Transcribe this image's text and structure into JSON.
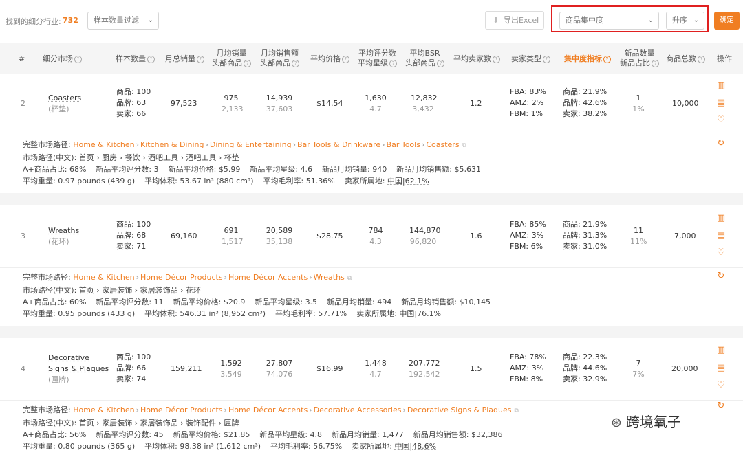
{
  "toolbar": {
    "found_label": "找到的细分行业:",
    "found_count": "732",
    "sample_filter": "样本数量过滤",
    "export": "导出Excel",
    "sort_field": "商品集中度",
    "sort_order": "升序",
    "confirm": "确定"
  },
  "headers": {
    "index": "#",
    "market": "细分市场",
    "sample": "样本数量",
    "total_sales": "月总销量",
    "avg_sales_1": "月均销量",
    "avg_sales_2": "头部商品",
    "avg_rev_1": "月均销售额",
    "avg_rev_2": "头部商品",
    "avg_price": "平均价格",
    "rating_1": "平均评分数",
    "rating_2": "平均星级",
    "bsr_1": "平均BSR",
    "bsr_2": "头部商品",
    "sellers": "平均卖家数",
    "seller_type": "卖家类型",
    "concentration": "集中度指标",
    "new_1": "新品数量",
    "new_2": "新品占比",
    "total_products": "商品总数",
    "ops": "操作"
  },
  "labels": {
    "product": "商品:",
    "brand": "品牌:",
    "seller": "卖家:",
    "fba": "FBA:",
    "amz": "AMZ:",
    "fbm": "FBM:",
    "full_path": "完整市场路径:",
    "path_cn": "市场路径(中文):",
    "aplus": "A+商品占比:",
    "new_rating_count": "新品平均评分数:",
    "new_price": "新品平均价格:",
    "new_stars": "新品平均星级:",
    "new_sales": "新品月均销量:",
    "new_revenue": "新品月均销售额:",
    "avg_weight": "平均重量:",
    "avg_volume": "平均体积:",
    "avg_margin": "平均毛利率:",
    "seller_origin": "卖家所属地:"
  },
  "rows": [
    {
      "index": "2",
      "name_en": "Coasters",
      "name_cn": "(杯垫)",
      "sample_products": "100",
      "sample_brands": "63",
      "sample_sellers": "66",
      "total_sales": "97,523",
      "avg_sales": "975",
      "avg_sales_top": "2,133",
      "avg_rev": "14,939",
      "avg_rev_top": "37,603",
      "price": "$14.54",
      "rating_count": "1,630",
      "rating_star": "4.7",
      "bsr": "12,832",
      "bsr_top": "3,432",
      "sellers": "1.2",
      "fba": "83%",
      "amz": "2%",
      "fbm": "1%",
      "conc_product": "21.9%",
      "conc_brand": "42.6%",
      "conc_seller": "38.2%",
      "new_count": "1",
      "new_ratio": "1%",
      "total_products": "10,000",
      "path_en": [
        "Home & Kitchen",
        "Kitchen & Dining",
        "Dining & Entertaining",
        "Bar Tools & Drinkware",
        "Bar Tools",
        "Coasters"
      ],
      "path_cn": "首页 › 厨房 › 餐饮 › 酒吧工具 › 酒吧工具 › 杯垫",
      "aplus": "68%",
      "new_rating_count": "3",
      "new_price": "$5.99",
      "new_stars": "4.6",
      "new_sales": "940",
      "new_revenue": "$5,631",
      "weight": "0.97 pounds (439 g)",
      "volume": "53.67 in³ (880 cm³)",
      "margin": "51.36%",
      "origin": "中国|62.1%"
    },
    {
      "index": "3",
      "name_en": "Wreaths",
      "name_cn": "(花环)",
      "sample_products": "100",
      "sample_brands": "68",
      "sample_sellers": "71",
      "total_sales": "69,160",
      "avg_sales": "691",
      "avg_sales_top": "1,517",
      "avg_rev": "20,589",
      "avg_rev_top": "35,138",
      "price": "$28.75",
      "rating_count": "784",
      "rating_star": "4.3",
      "bsr": "144,870",
      "bsr_top": "96,820",
      "sellers": "1.6",
      "fba": "85%",
      "amz": "3%",
      "fbm": "6%",
      "conc_product": "21.9%",
      "conc_brand": "31.3%",
      "conc_seller": "31.0%",
      "new_count": "11",
      "new_ratio": "11%",
      "total_products": "7,000",
      "path_en": [
        "Home & Kitchen",
        "Home Décor Products",
        "Home Décor Accents",
        "Wreaths"
      ],
      "path_cn": "首页 › 家居装饰 › 家居装饰品 › 花环",
      "aplus": "60%",
      "new_rating_count": "11",
      "new_price": "$20.9",
      "new_stars": "3.5",
      "new_sales": "494",
      "new_revenue": "$10,145",
      "weight": "0.95 pounds (433 g)",
      "volume": "546.31 in³ (8,952 cm³)",
      "margin": "57.71%",
      "origin": "中国|76.1%"
    },
    {
      "index": "4",
      "name_en": "Decorative",
      "name_en2": "Signs & Plaques",
      "name_cn": "(匾牌)",
      "sample_products": "100",
      "sample_brands": "66",
      "sample_sellers": "74",
      "total_sales": "159,211",
      "avg_sales": "1,592",
      "avg_sales_top": "3,549",
      "avg_rev": "27,807",
      "avg_rev_top": "74,076",
      "price": "$16.99",
      "rating_count": "1,448",
      "rating_star": "4.7",
      "bsr": "207,772",
      "bsr_top": "192,542",
      "sellers": "1.5",
      "fba": "78%",
      "amz": "3%",
      "fbm": "8%",
      "conc_product": "22.3%",
      "conc_brand": "44.6%",
      "conc_seller": "32.9%",
      "new_count": "7",
      "new_ratio": "7%",
      "total_products": "20,000",
      "path_en": [
        "Home & Kitchen",
        "Home Décor Products",
        "Home Décor Accents",
        "Decorative Accessories",
        "Decorative Signs & Plaques"
      ],
      "path_cn": "首页 › 家居装饰 › 家居装饰品 › 装饰配件 › 匾牌",
      "aplus": "56%",
      "new_rating_count": "45",
      "new_price": "$21.85",
      "new_stars": "4.8",
      "new_sales": "1,477",
      "new_revenue": "$32,386",
      "weight": "0.80 pounds (365 g)",
      "volume": "98.38 in³ (1,612 cm³)",
      "margin": "56.75%",
      "origin": "中国|48.6%"
    }
  ],
  "watermark": "跨境氧子"
}
